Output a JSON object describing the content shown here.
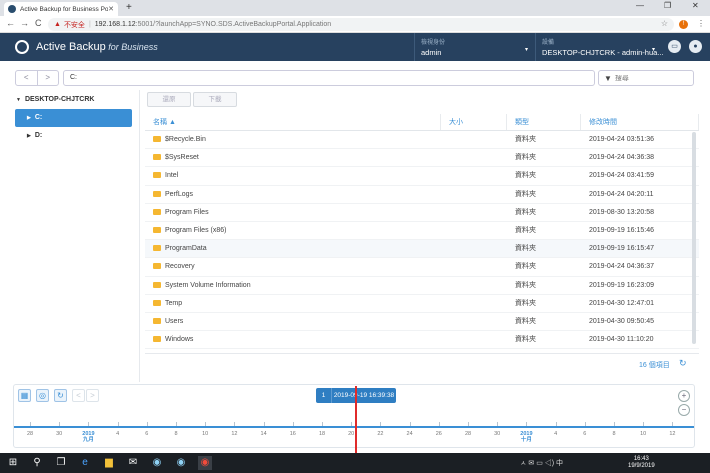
{
  "browser": {
    "tab_title": "Active Backup for Business Po...",
    "tab_close": "✕",
    "new_tab": "+",
    "minimize": "—",
    "restore": "❐",
    "close": "✕",
    "back": "←",
    "forward": "→",
    "reload": "C",
    "security_label": "不安全",
    "url_host": "192.168.1.12",
    "url_rest": ":5001/?launchApp=SYNO.SDS.ActiveBackupPortal.Application",
    "profile_initial": "!",
    "menu": "⋮",
    "star": "☆"
  },
  "header": {
    "app_name": "Active Backup",
    "app_name_suffix": " for Business",
    "identity_label": "檢視身份",
    "identity_value": "admin",
    "device_label": "設備",
    "device_value": "DESKTOP-CHJTCRK - admin-hua...",
    "caret": "▾",
    "msg_icon": "▭",
    "user_icon": "●"
  },
  "toolbar": {
    "back": "<",
    "forward": ">",
    "path": "C:",
    "search_placeholder": "搜尋",
    "filter_icon": "▼"
  },
  "sidebar": {
    "root": "DESKTOP-CHJTCRK",
    "root_arrow": "▼",
    "items": [
      {
        "label": "C:",
        "arrow": "▶"
      },
      {
        "label": "D:",
        "arrow": "▶"
      }
    ]
  },
  "actions": {
    "restore": "還原",
    "download": "下載"
  },
  "grid": {
    "headers": [
      "名稱",
      "大小",
      "類型",
      "修改時間"
    ],
    "sort_indicator": "▲",
    "rows": [
      {
        "name": "$Recycle.Bin",
        "size": "",
        "type": "資料夾",
        "modified": "2019-04-24 03:51:36"
      },
      {
        "name": "$SysReset",
        "size": "",
        "type": "資料夾",
        "modified": "2019-04-24 04:36:38"
      },
      {
        "name": "Intel",
        "size": "",
        "type": "資料夾",
        "modified": "2019-04-24 03:41:59"
      },
      {
        "name": "PerfLogs",
        "size": "",
        "type": "資料夾",
        "modified": "2019-04-24 04:20:11"
      },
      {
        "name": "Program Files",
        "size": "",
        "type": "資料夾",
        "modified": "2019-08-30 13:20:58"
      },
      {
        "name": "Program Files (x86)",
        "size": "",
        "type": "資料夾",
        "modified": "2019-09-19 16:15:46"
      },
      {
        "name": "ProgramData",
        "size": "",
        "type": "資料夾",
        "modified": "2019-09-19 16:15:47"
      },
      {
        "name": "Recovery",
        "size": "",
        "type": "資料夾",
        "modified": "2019-04-24 04:36:37"
      },
      {
        "name": "System Volume Information",
        "size": "",
        "type": "資料夾",
        "modified": "2019-09-19 16:23:09"
      },
      {
        "name": "Temp",
        "size": "",
        "type": "資料夾",
        "modified": "2019-04-30 12:47:01"
      },
      {
        "name": "Users",
        "size": "",
        "type": "資料夾",
        "modified": "2019-04-30 09:50:45"
      },
      {
        "name": "Windows",
        "size": "",
        "type": "資料夾",
        "modified": "2019-04-30 11:10:20"
      }
    ],
    "item_count": "16 個項目",
    "refresh": "↻"
  },
  "timeline": {
    "btn_calendar": "▦",
    "btn_locate": "◎",
    "btn_refresh": "↻",
    "btn_prev": "<",
    "btn_next": ">",
    "version_index": "1",
    "version_time": "2019-09-19 16:39:38",
    "zoom_in": "+",
    "zoom_out": "−",
    "ticks": [
      {
        "day": "28"
      },
      {
        "day": "30"
      },
      {
        "day": "2019",
        "month": "九月",
        "year": true
      },
      {
        "day": "4"
      },
      {
        "day": "6"
      },
      {
        "day": "8"
      },
      {
        "day": "10"
      },
      {
        "day": "12"
      },
      {
        "day": "14"
      },
      {
        "day": "16"
      },
      {
        "day": "18"
      },
      {
        "day": "20"
      },
      {
        "day": "22"
      },
      {
        "day": "24"
      },
      {
        "day": "26"
      },
      {
        "day": "28"
      },
      {
        "day": "30"
      },
      {
        "day": "2019",
        "month": "十月",
        "year": true
      },
      {
        "day": "4"
      },
      {
        "day": "6"
      },
      {
        "day": "8"
      },
      {
        "day": "10"
      },
      {
        "day": "12"
      }
    ]
  },
  "taskbar": {
    "start": "⊞",
    "search": "⚲",
    "taskview": "❐",
    "apps": [
      "e",
      "▆",
      "✉",
      "◉",
      "◉",
      "◉"
    ],
    "clock_time": "16:43",
    "clock_date": "19/9/2019",
    "tray": "ㅅ ✉ ▭ ◁) 中"
  },
  "colors": {
    "header_bg": "#27415f",
    "accent": "#3a8fd5",
    "cursor": "#e02b2b",
    "folder": "#f5b731"
  }
}
